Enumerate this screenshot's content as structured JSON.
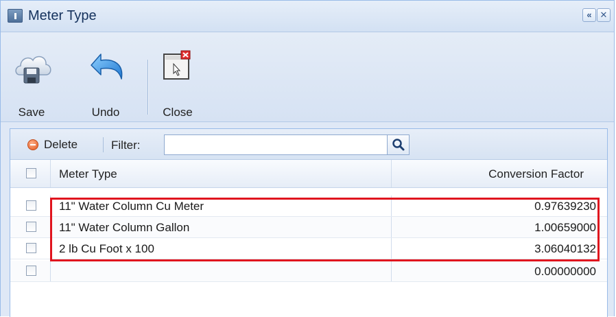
{
  "window": {
    "title": "Meter Type",
    "icon": "info-window-icon",
    "buttons": [
      {
        "name": "collapse",
        "glyph": "«"
      },
      {
        "name": "close",
        "glyph": "✕"
      }
    ]
  },
  "toolbar": {
    "save_label": "Save",
    "undo_label": "Undo",
    "close_label": "Close"
  },
  "grid": {
    "toolbar": {
      "delete_label": "Delete",
      "filter_label": "Filter:",
      "filter_value": "",
      "filter_placeholder": ""
    },
    "columns": [
      "Meter Type",
      "Conversion Factor"
    ],
    "rows": [
      {
        "meter_type": "11\" Water Column Cu Meter",
        "conversion_factor": "0.97639230"
      },
      {
        "meter_type": "11\" Water Column Gallon",
        "conversion_factor": "1.00659000"
      },
      {
        "meter_type": "2 lb Cu Foot x 100",
        "conversion_factor": "3.06040132"
      },
      {
        "meter_type": "",
        "conversion_factor": "0.00000000"
      }
    ]
  },
  "colors": {
    "highlight": "#e0141e",
    "accent": "#99bbe8"
  }
}
